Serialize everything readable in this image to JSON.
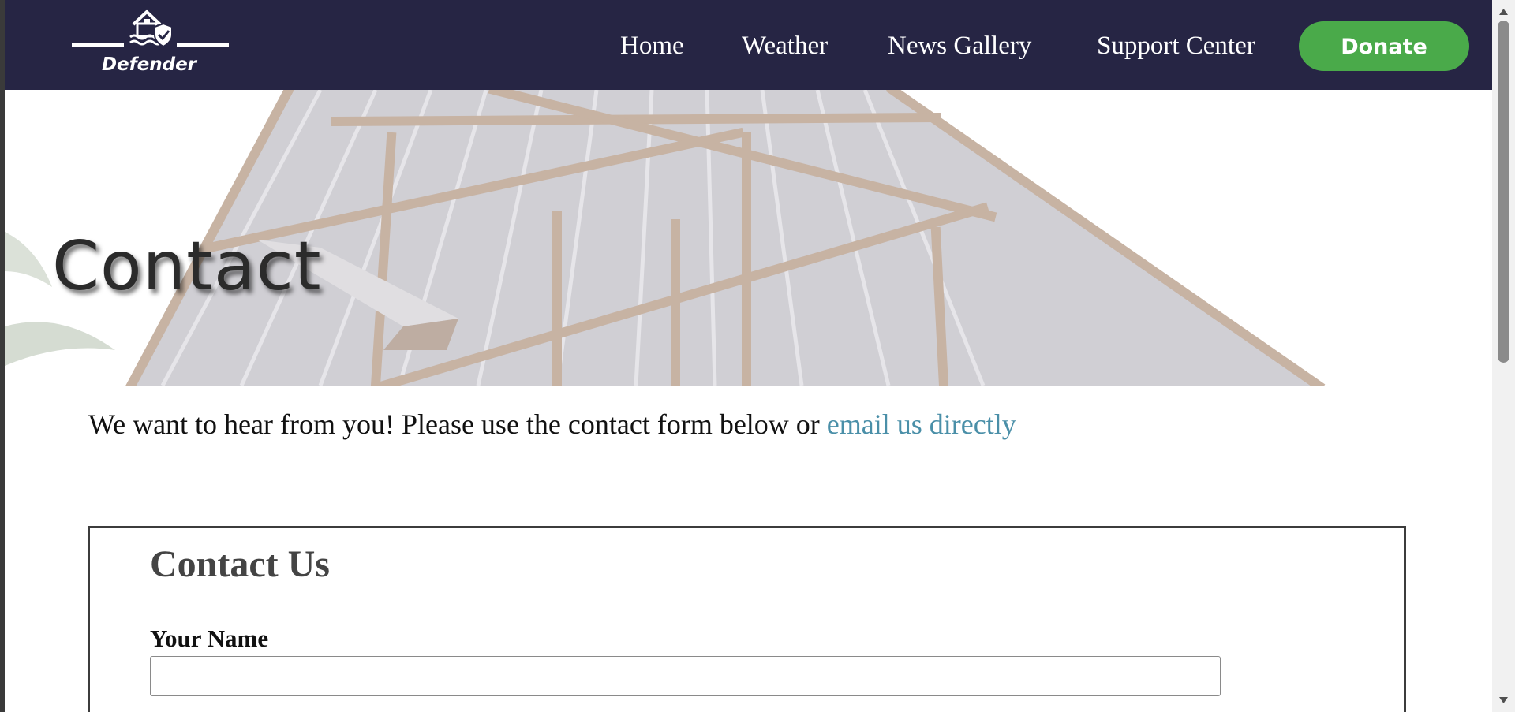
{
  "logo": {
    "text": "Defender",
    "icon": "house-shield-icon"
  },
  "nav": {
    "items": [
      {
        "label": "Home"
      },
      {
        "label": "Weather"
      },
      {
        "label": "News Gallery"
      },
      {
        "label": "Support Center"
      }
    ],
    "donate_label": "Donate"
  },
  "hero": {
    "title": "Contact"
  },
  "intro": {
    "text": "We want to hear from you! Please use the contact form below or ",
    "link_text": "email us directly"
  },
  "form": {
    "title": "Contact Us",
    "name_label": "Your Name",
    "name_value": ""
  },
  "colors": {
    "header_bg": "#262544",
    "donate_bg": "#4aaa4a",
    "link": "#4a8fa8"
  }
}
